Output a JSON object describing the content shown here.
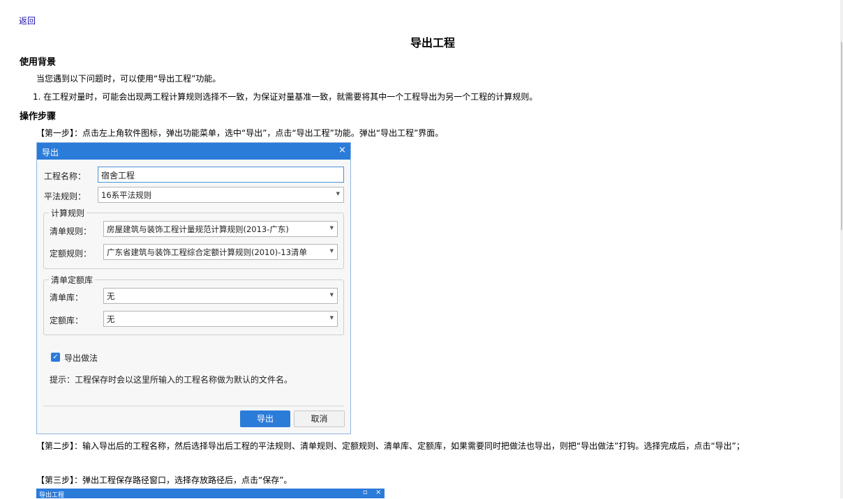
{
  "nav": {
    "back": "返回"
  },
  "title": "导出工程",
  "sections": {
    "background_heading": "使用背景",
    "background_text": "当您遇到以下问题时，可以使用“导出工程”功能。",
    "background_item1": "1. 在工程对量时，可能会出现两工程计算规则选择不一致，为保证对量基准一致，就需要将其中一个工程导出为另一个工程的计算规则。",
    "steps_heading": "操作步骤",
    "step1": "【第一步】：点击左上角软件图标，弹出功能菜单，选中“导出”，点击“导出工程”功能。弹出“导出工程”界面。",
    "step2": "【第二步】：输入导出后的工程名称，然后选择导出后工程的平法规则、清单规则、定额规则、清单库、定额库，如果需要同时把做法也导出，则把“导出做法”打钩。选择完成后，点击“导出”；",
    "step3": "【第三步】：弹出工程保存路径窗口，选择存放路径后，点击“保存”。"
  },
  "dialog": {
    "title": "导出",
    "close_glyph": "×",
    "project_name_label": "工程名称：",
    "project_name_value": "宿舍工程",
    "flat_rule_label": "平法规则：",
    "flat_rule_value": "16系平法规则",
    "calc_group_legend": "计算规则",
    "list_rule_label": "清单规则：",
    "list_rule_value": "房屋建筑与装饰工程计量规范计算规则(2013-广东)",
    "quota_rule_label": "定额规则：",
    "quota_rule_value": "广东省建筑与装饰工程综合定额计算规则(2010)-13清单",
    "lib_group_legend": "清单定额库",
    "list_lib_label": "清单库：",
    "list_lib_value": "无",
    "quota_lib_label": "定额库：",
    "quota_lib_value": "无",
    "export_method_label": "导出做法",
    "export_method_checked": true,
    "hint": "提示：工程保存时会以这里所输入的工程名称做为默认的文件名。",
    "export_button": "导出",
    "cancel_button": "取消"
  },
  "window2": {
    "title": "导出工程",
    "min_glyph": "▫",
    "close_glyph": "×"
  },
  "colors": {
    "accent": "#2b7bd9",
    "link": "#1a0dab"
  }
}
